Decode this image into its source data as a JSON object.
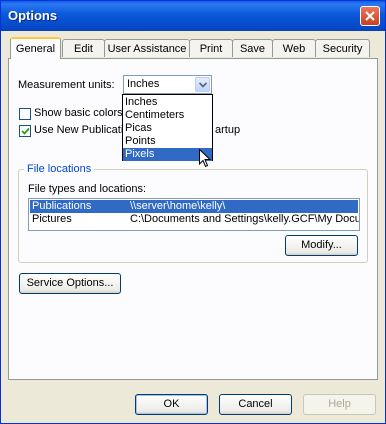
{
  "window": {
    "title": "Options"
  },
  "tabs": [
    "General",
    "Edit",
    "User Assistance",
    "Print",
    "Save",
    "Web",
    "Security"
  ],
  "general": {
    "measurement_label": "Measurement units:",
    "measurement_value": "Inches",
    "units_options": [
      "Inches",
      "Centimeters",
      "Picas",
      "Points",
      "Pixels"
    ],
    "units_highlighted": "Pixels",
    "show_basic_colors_label": "Show basic colors i",
    "use_new_pub_label": "Use New Publicatio",
    "use_new_pub_suffix": "artup",
    "file_locations_title": "File locations",
    "file_types_label": "File types and locations:",
    "file_rows": [
      {
        "type": "Publications",
        "location": "\\\\server\\home\\kelly\\"
      },
      {
        "type": "Pictures",
        "location": "C:\\Documents and Settings\\kelly.GCF\\My Docur"
      }
    ],
    "modify_button": "Modify...",
    "service_options_button": "Service Options..."
  },
  "footer": {
    "ok": "OK",
    "cancel": "Cancel",
    "help": "Help"
  }
}
